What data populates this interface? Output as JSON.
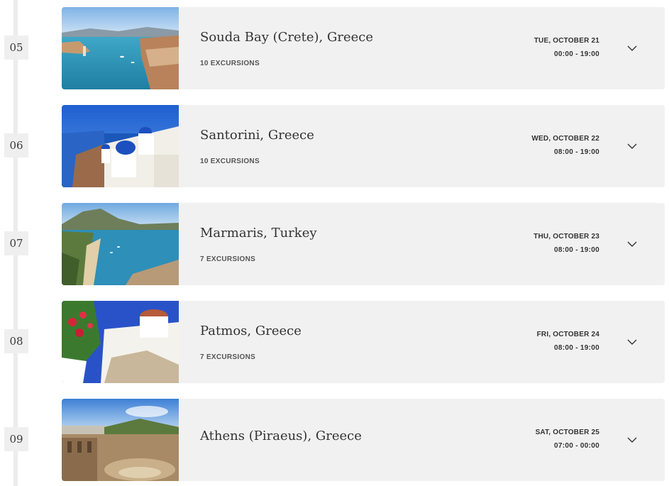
{
  "ports": [
    {
      "day": "05",
      "name": "Souda Bay (Crete), Greece",
      "excursions": "10 EXCURSIONS",
      "date": "TUE, OCTOBER 21",
      "hours": "00:00 - 19:00"
    },
    {
      "day": "06",
      "name": "Santorini, Greece",
      "excursions": "10 EXCURSIONS",
      "date": "WED, OCTOBER 22",
      "hours": "08:00 - 19:00"
    },
    {
      "day": "07",
      "name": "Marmaris, Turkey",
      "excursions": "7 EXCURSIONS",
      "date": "THU, OCTOBER 23",
      "hours": "08:00 - 19:00"
    },
    {
      "day": "08",
      "name": "Patmos, Greece",
      "excursions": "7 EXCURSIONS",
      "date": "FRI, OCTOBER 24",
      "hours": "08:00 - 19:00"
    },
    {
      "day": "09",
      "name": "Athens (Piraeus), Greece",
      "excursions": "",
      "date": "SAT, OCTOBER 25",
      "hours": "07:00 - 00:00"
    }
  ],
  "icons": {
    "expand": "chevron-down-icon"
  },
  "colors": {
    "card_background": "#f1f1f1",
    "timeline": "#ececec",
    "badge_background": "#efefef",
    "text_dark": "#333333"
  }
}
